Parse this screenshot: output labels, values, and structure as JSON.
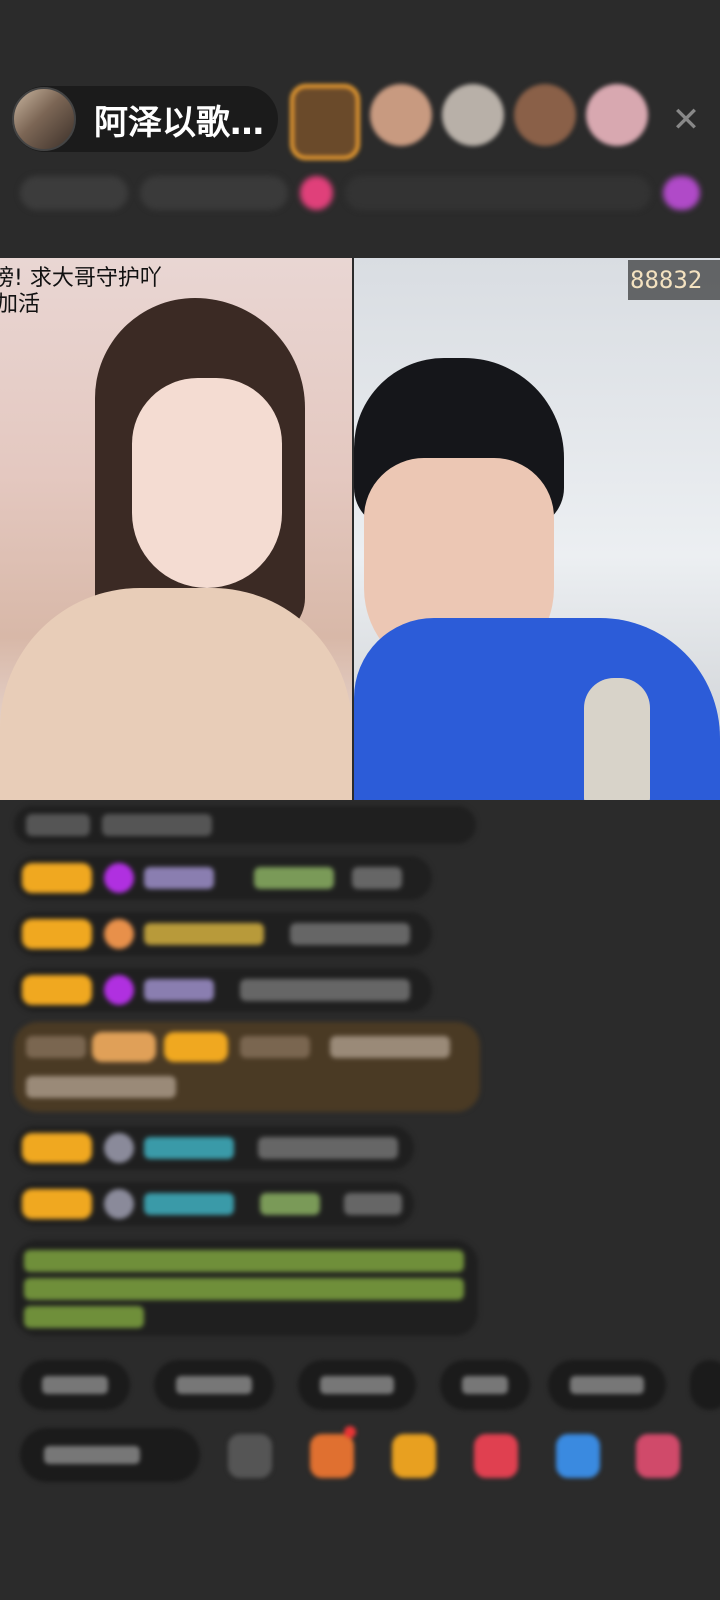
{
  "header": {
    "host_name": "阿泽以歌…",
    "close_icon": "close-icon"
  },
  "video": {
    "left_overlay_line1": "榜! 求大哥守护吖",
    "left_overlay_line2": "加活",
    "right_vote_count": "88832"
  },
  "chat": {
    "messages": [
      "",
      "",
      "",
      "",
      "",
      "",
      "",
      "",
      ""
    ]
  },
  "quick_replies": [
    "",
    "",
    "",
    "",
    "",
    ""
  ],
  "bottom": {
    "input_placeholder": "",
    "actions": [
      "menu-icon",
      "gift-box-icon",
      "red-packet-icon",
      "heart-icon",
      "game-icon",
      "more-icon"
    ]
  },
  "colors": {
    "background": "#2b2b2b",
    "badge_gold": "#f0a820",
    "gift_purple": "#b030e0",
    "name_teal": "#3a9aa8",
    "system_green": "#8fbf3a",
    "highlight_brown": "#4a3a24"
  }
}
